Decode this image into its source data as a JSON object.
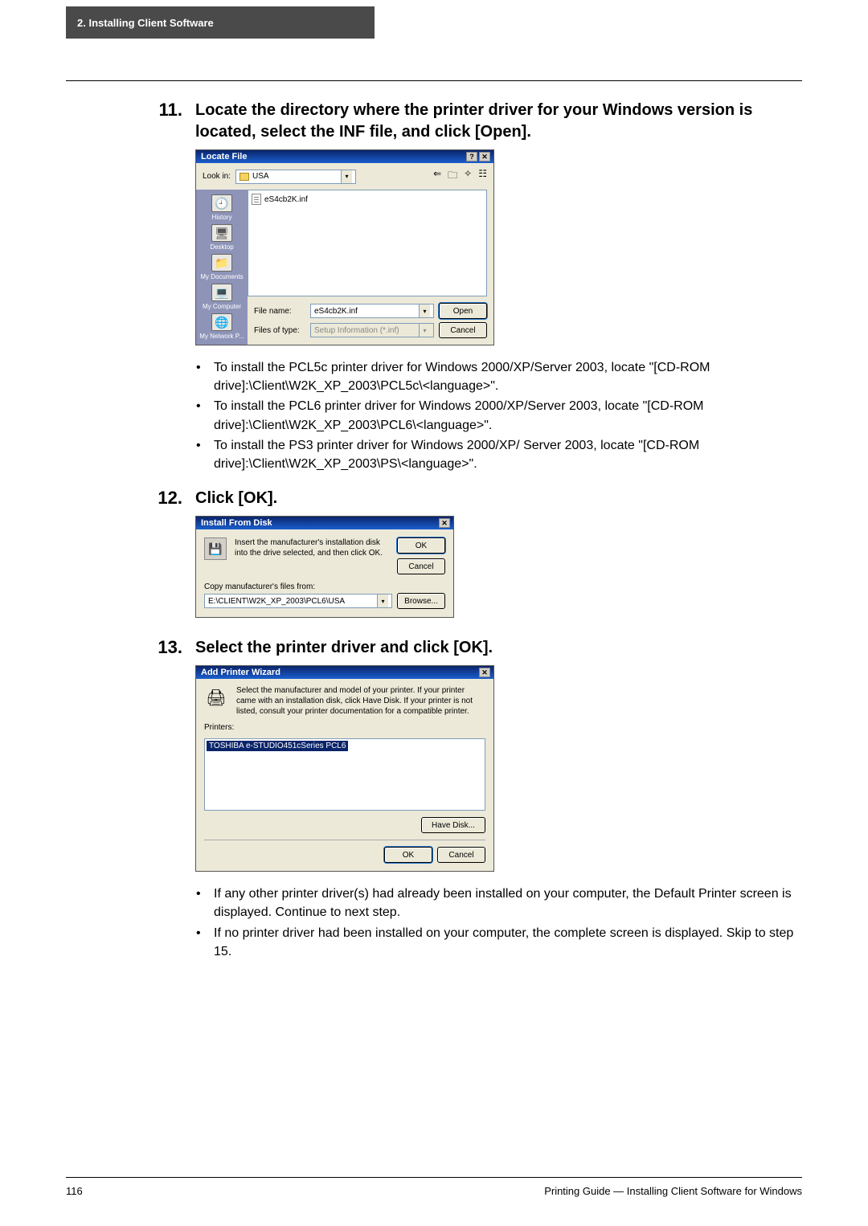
{
  "header": {
    "tab": "2. Installing Client Software"
  },
  "step11": {
    "num": "11.",
    "title": "Locate the directory where the printer driver for your Windows version is located, select the INF file, and click [Open]."
  },
  "locate": {
    "title": "Locate File",
    "lookin_label": "Look in:",
    "lookin_value": "USA",
    "file_item": "eS4cb2K.inf",
    "places": {
      "history": "History",
      "desktop": "Desktop",
      "mydocs": "My Documents",
      "mycomp": "My Computer",
      "mynet": "My Network P..."
    },
    "filename_label": "File name:",
    "filename_value": "eS4cb2K.inf",
    "filetype_label": "Files of type:",
    "filetype_value": "Setup Information (*.inf)",
    "open": "Open",
    "cancel": "Cancel"
  },
  "bullets11": {
    "b1": "To install the PCL5c printer driver for Windows 2000/XP/Server 2003, locate \"[CD-ROM drive]:\\Client\\W2K_XP_2003\\PCL5c\\<language>\".",
    "b2": "To install the PCL6 printer driver for Windows 2000/XP/Server 2003, locate \"[CD-ROM drive]:\\Client\\W2K_XP_2003\\PCL6\\<language>\".",
    "b3": "To install the PS3 printer driver for Windows 2000/XP/ Server 2003, locate \"[CD-ROM drive]:\\Client\\W2K_XP_2003\\PS\\<language>\"."
  },
  "step12": {
    "num": "12.",
    "title": "Click [OK]."
  },
  "install": {
    "title": "Install From Disk",
    "text": "Insert the manufacturer's installation disk into the drive selected, and then click OK.",
    "ok": "OK",
    "cancel": "Cancel",
    "copyfrom": "Copy manufacturer's files from:",
    "path": "E:\\CLIENT\\W2K_XP_2003\\PCL6\\USA",
    "browse": "Browse..."
  },
  "step13": {
    "num": "13.",
    "title": "Select the printer driver and click [OK]."
  },
  "wizard": {
    "title": "Add Printer Wizard",
    "text": "Select the manufacturer and model of your printer. If your printer came with an installation disk, click Have Disk. If your printer is not listed, consult your printer documentation for a compatible printer.",
    "printers_label": "Printers:",
    "selected": "TOSHIBA e-STUDIO451cSeries PCL6",
    "havedisk": "Have Disk...",
    "ok": "OK",
    "cancel": "Cancel"
  },
  "bullets13": {
    "b1": "If any other printer driver(s) had already been installed on your computer, the Default Printer screen is displayed.  Continue to next step.",
    "b2": "If no printer driver had been installed on your computer, the complete screen is displayed.   Skip to step 15."
  },
  "footer": {
    "page": "116",
    "text": "Printing Guide — Installing Client Software for Windows"
  },
  "glyphs": {
    "dot": "•",
    "qmark": "?",
    "close": "✕",
    "back": "⇐",
    "up": "🗀",
    "new": "✧",
    "views": "☷",
    "disk": "💾",
    "printer": "🖨",
    "dd": "▾"
  }
}
